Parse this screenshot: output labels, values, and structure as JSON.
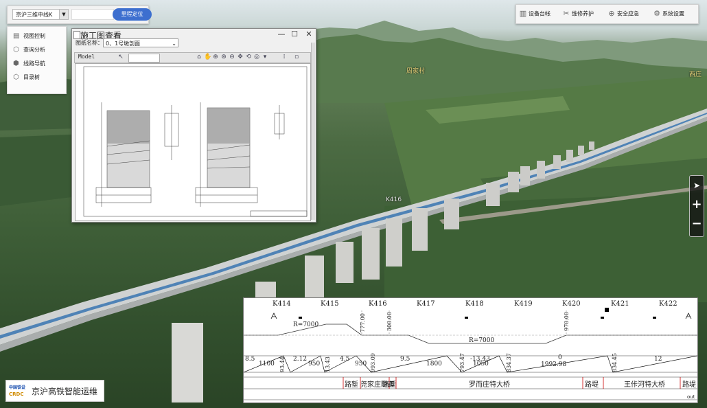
{
  "search_bar": {
    "line_select": "京沪三维中线K",
    "mileage_input": "",
    "locate_button": "里程定位"
  },
  "left_menu": {
    "items": [
      {
        "icon": "layers-icon",
        "label": "视图控制"
      },
      {
        "icon": "query-icon",
        "label": "查询分析"
      },
      {
        "icon": "route-icon",
        "label": "线路导航"
      },
      {
        "icon": "tree-icon",
        "label": "目录树"
      }
    ]
  },
  "toolbar": {
    "items": [
      {
        "icon": "ledger-icon",
        "label": "设备台帐"
      },
      {
        "icon": "wrench-icon",
        "label": "维修养护"
      },
      {
        "icon": "shield-icon",
        "label": "安全应急"
      },
      {
        "icon": "gear-icon",
        "label": "系统设置"
      }
    ]
  },
  "scene": {
    "place_label_1": "周家村",
    "place_label_2": "西庄",
    "marker": "K416"
  },
  "viewer": {
    "title": "施工图查看",
    "sheet_label": "图纸名称：",
    "sheet_value": "0、1号墩剖面",
    "model_tab": "Model"
  },
  "profile": {
    "km_labels": [
      "K414",
      "K415",
      "K416",
      "K417",
      "K418",
      "K419",
      "K420",
      "K421",
      "K422"
    ],
    "elevations": [
      "777.00",
      "300.00",
      "970.00"
    ],
    "radius_1": "R=7000",
    "radius_2": "R=7000",
    "grades": [
      "8.5",
      "2.12",
      "4.5",
      "9.5",
      "-13.43",
      "0",
      "12"
    ],
    "grade_lengths": [
      "1100",
      "950",
      "950",
      "1800",
      "1050",
      "1992.98"
    ],
    "breakpoint_labels": [
      "93.44",
      "13.43",
      "993.09",
      "793.47",
      "834.37",
      "834.45"
    ],
    "structures": [
      "路堑",
      "尧家庄隧道",
      "路堑",
      "罗而庄特大桥",
      "路堤",
      "王佧河特大桥",
      "路堤"
    ],
    "out_label": "out"
  },
  "logo": {
    "org_cn": "中国铁设",
    "org_en": "CRDC",
    "system_name": "京沪高铁智能运维"
  }
}
